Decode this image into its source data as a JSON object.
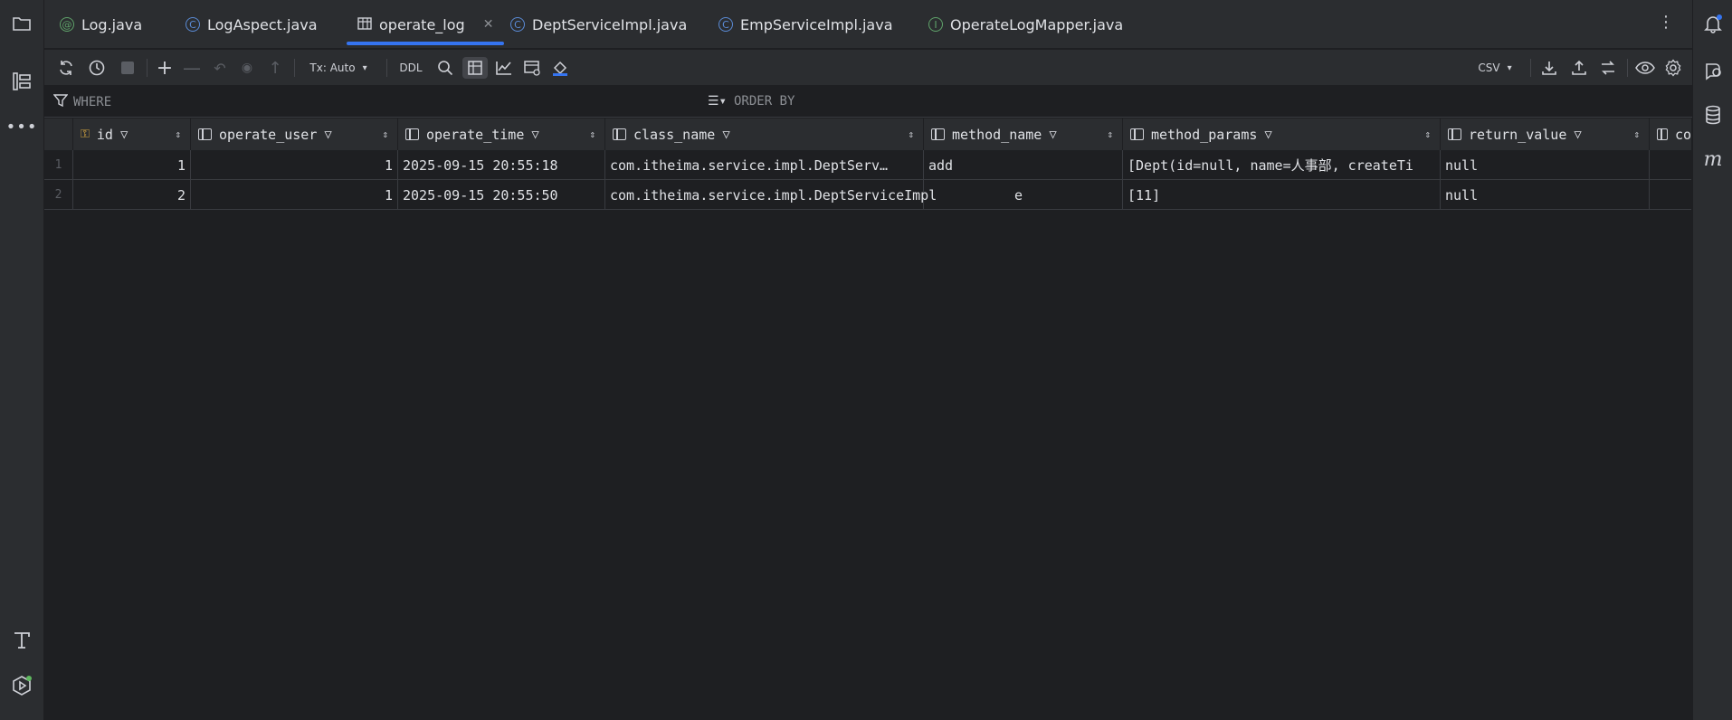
{
  "tabs": [
    {
      "label": "Log.java",
      "icon": "annotation-icon",
      "glyph": "@"
    },
    {
      "label": "LogAspect.java",
      "icon": "class-icon",
      "glyph": "C"
    },
    {
      "label": "operate_log",
      "icon": "table-icon",
      "glyph": ""
    },
    {
      "label": "DeptServiceImpl.java",
      "icon": "class-icon",
      "glyph": "C"
    },
    {
      "label": "EmpServiceImpl.java",
      "icon": "class-icon",
      "glyph": "C"
    },
    {
      "label": "OperateLogMapper.java",
      "icon": "interface-icon",
      "glyph": "I"
    }
  ],
  "active_tab": "operate_log",
  "toolbar": {
    "tx_mode": "Tx: Auto",
    "ddl": "DDL",
    "export_format": "CSV"
  },
  "filter": {
    "where": "WHERE",
    "order_by": "ORDER BY"
  },
  "columns": [
    "id",
    "operate_user",
    "operate_time",
    "class_name",
    "method_name",
    "method_params",
    "return_value",
    "co"
  ],
  "rows": [
    {
      "rownum": "1",
      "id": "1",
      "operate_user": "1",
      "operate_time": "2025-09-15 20:55:18",
      "class_name": "com.itheima.service.impl.DeptServ…",
      "method_name": "add",
      "method_params": "[Dept(id=null, name=人事部, createTi",
      "return_value": "null"
    },
    {
      "rownum": "2",
      "id": "2",
      "operate_user": "1",
      "operate_time": "2025-09-15 20:55:50",
      "class_name": "com.itheima.service.impl.DeptServiceImpl",
      "method_name": "e",
      "method_params": "[11]",
      "return_value": "null"
    }
  ],
  "colors": {
    "background": "#1e1f22",
    "panel": "#2b2d30",
    "accent": "#3574f0",
    "text": "#dfe1e5"
  }
}
